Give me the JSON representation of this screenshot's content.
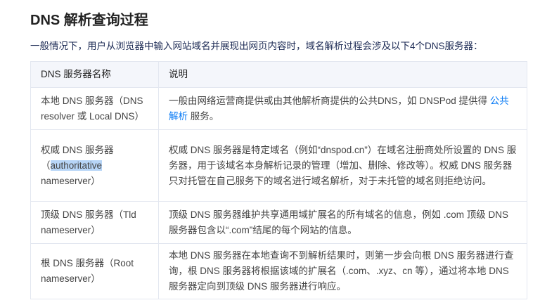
{
  "title": "DNS 解析查询过程",
  "intro": "一般情况下，用户从浏览器中输入网站域名并展现出网页内容时，域名解析过程会涉及以下4个DNS服务器：",
  "table": {
    "headers": [
      "DNS 服务器名称",
      "说明"
    ],
    "rows": [
      {
        "name": "本地 DNS 服务器（DNS resolver 或 Local DNS）",
        "desc_before": "一般由网络运营商提供或由其他解析商提供的公共DNS，如 DNSPod 提供得 ",
        "desc_link": "公共解析",
        "desc_after": " 服务。"
      },
      {
        "name_before": "权威 DNS 服务器（",
        "name_selected": "authoritative",
        "name_after": " nameserver）",
        "desc": "权威 DNS 服务器是特定域名（例如“dnspod.cn”）在域名注册商处所设置的 DNS 服务器，用于该域名本身解析记录的管理（增加、删除、修改等）。权威 DNS 服务器只对托管在自己服务下的域名进行域名解析，对于未托管的域名则拒绝访问。"
      },
      {
        "name": "顶级 DNS 服务器（Tld nameserver）",
        "desc": "顶级 DNS 服务器维护共享通用域扩展名的所有域名的信息，例如 .com 顶级 DNS 服务器包含以“.com”结尾的每个网站的信息。"
      },
      {
        "name": "根 DNS 服务器（Root nameserver）",
        "desc": "本地 DNS 服务器在本地查询不到解析结果时，则第一步会向根 DNS 服务器进行查询，根 DNS 服务器将根据该域的扩展名（.com、.xyz、cn 等），通过将本地 DNS 服务器定向到顶级 DNS 服务器进行响应。"
      }
    ]
  },
  "colors": {
    "link": "#0a7bf5",
    "intro": "#1d2b55",
    "header_bg": "#f4f6fb",
    "selection": "#b7d5f7"
  }
}
